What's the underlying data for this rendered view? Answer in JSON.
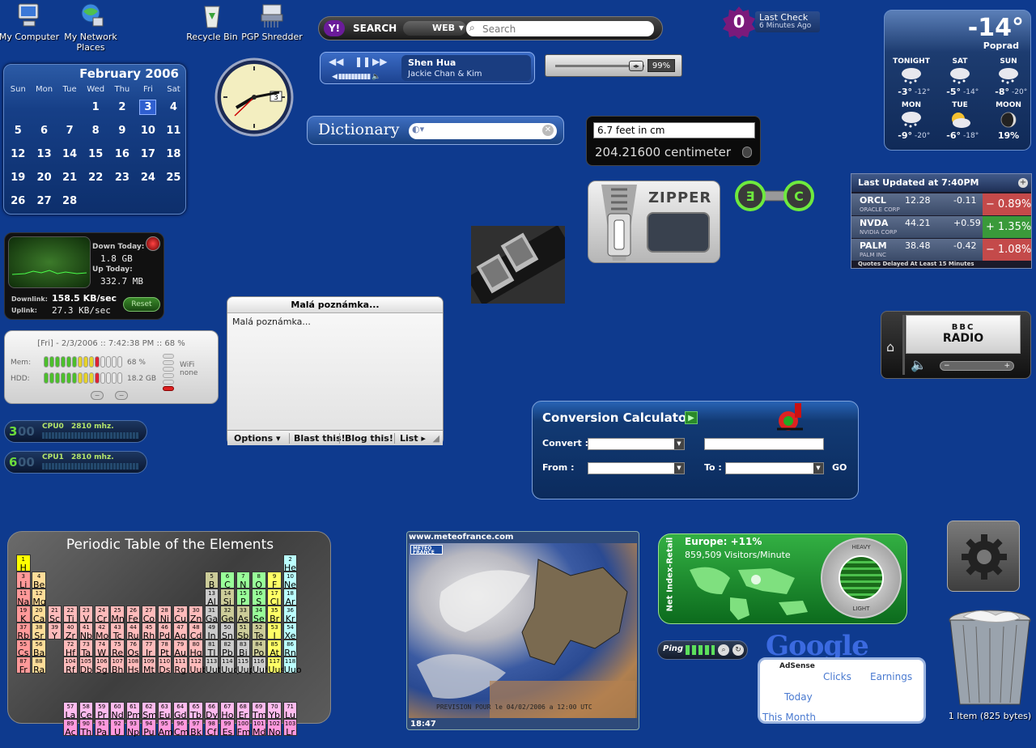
{
  "desktop_icons": [
    {
      "label": "My Computer",
      "icon": "computer-icon"
    },
    {
      "label": "My Network Places",
      "icon": "network-icon"
    },
    {
      "label": "Recycle Bin",
      "icon": "recycle-bin-icon"
    },
    {
      "label": "PGP Shredder",
      "icon": "shredder-icon"
    }
  ],
  "calendar": {
    "month_title": "February 2006",
    "weekdays": [
      "Sun",
      "Mon",
      "Tue",
      "Wed",
      "Thu",
      "Fri",
      "Sat"
    ],
    "weeks": [
      [
        "",
        "",
        "",
        "1",
        "2",
        "3",
        "4"
      ],
      [
        "5",
        "6",
        "7",
        "8",
        "9",
        "10",
        "11"
      ],
      [
        "12",
        "13",
        "14",
        "15",
        "16",
        "17",
        "18"
      ],
      [
        "19",
        "20",
        "21",
        "22",
        "23",
        "24",
        "25"
      ],
      [
        "26",
        "27",
        "28",
        "",
        "",
        "",
        ""
      ]
    ],
    "today": "3"
  },
  "clock": {
    "date_box": "3"
  },
  "yahoo_search": {
    "brand": "Y!",
    "button_label": "SEARCH",
    "scope": "WEB",
    "placeholder": "Search"
  },
  "media_player": {
    "track": "Shen Hua",
    "artist": "Jackie Chan & Kim"
  },
  "volume": {
    "percent_text": "99%",
    "level": 0.99
  },
  "dictionary": {
    "title": "Dictionary",
    "query": ""
  },
  "unit_converter": {
    "input_value": "6.7 feet in cm",
    "result": "204.21600 centimeter"
  },
  "last_check": {
    "count": "0",
    "title": "Last Check",
    "subtitle": "6 Minutes Ago"
  },
  "weather": {
    "temp": "-14°",
    "location": "Poprad",
    "row1": [
      {
        "label": "TONIGHT",
        "hi": "-3°",
        "lo": "-12°"
      },
      {
        "label": "SAT",
        "hi": "-5°",
        "lo": "-14°"
      },
      {
        "label": "SUN",
        "hi": "-8°",
        "lo": "-20°"
      }
    ],
    "row2": [
      {
        "label": "MON",
        "hi": "-9°",
        "lo": "-20°"
      },
      {
        "label": "TUE",
        "hi": "-6°",
        "lo": "-18°"
      },
      {
        "label": "MOON",
        "hi": "19%",
        "lo": ""
      }
    ]
  },
  "zipper": {
    "title": "ZIPPER"
  },
  "stocks": {
    "header": "Last Updated at 7:40PM",
    "rows": [
      {
        "symbol": "ORCL",
        "name": "ORACLE CORP",
        "price": "12.28",
        "change": "-0.11",
        "pct": "0.89%",
        "sign": "−",
        "color": "#c44a4a"
      },
      {
        "symbol": "NVDA",
        "name": "NVIDIA CORP",
        "price": "44.21",
        "change": "+0.59",
        "pct": "1.35%",
        "sign": "+",
        "color": "#3a9a3a"
      },
      {
        "symbol": "PALM",
        "name": "PALM INC",
        "price": "38.48",
        "change": "-0.42",
        "pct": "1.08%",
        "sign": "−",
        "color": "#c44a4a"
      }
    ],
    "footer": "Quotes Delayed At Least 15 Minutes"
  },
  "network_meter": {
    "down_today_label": "Down Today:",
    "down_today": "1.8 GB",
    "up_today_label": "Up Today:",
    "up_today": "332.7 MB",
    "downlink_label": "Downlink:",
    "downlink": "158.5 KB/sec",
    "uplink_label": "Uplink:",
    "uplink": "27.3 KB/sec",
    "reset": "Reset"
  },
  "system_monitor": {
    "header": "[Fri] - 2/3/2006 :: 7:42:38 PM :: 68 %",
    "mem_label": "Mem:",
    "mem_value": "68 %",
    "mem_level": 0.68,
    "hdd_label": "HDD:",
    "hdd_value": "18.2 GB",
    "wifi_label": "WiFi",
    "wifi_value": "none"
  },
  "note": {
    "title": "Malá poznámka...",
    "body": "Malá poznámka...",
    "buttons": [
      "Options ▾",
      "Blast this!",
      "Blog this!",
      "List ▸"
    ]
  },
  "cpu_meters": [
    {
      "digit": "3",
      "faded": "00",
      "label": "CPU0",
      "mhz": "2810 mhz."
    },
    {
      "digit": "6",
      "faded": "00",
      "label": "CPU1",
      "mhz": "2810 mhz."
    }
  ],
  "converter": {
    "title": "Conversion Calculator",
    "convert_label": "Convert :",
    "from_label": "From :",
    "to_label": "To :",
    "go": "GO"
  },
  "bbc_radio": {
    "logo": "BBC",
    "name": "RADIO"
  },
  "periodic": {
    "title": "Periodic Table of the Elements",
    "elements": [
      [
        "1",
        "H",
        1,
        1,
        "#ff0"
      ],
      [
        "2",
        "He",
        18,
        1,
        "#bff"
      ],
      [
        "3",
        "Li",
        1,
        2,
        "#f99"
      ],
      [
        "4",
        "Be",
        2,
        2,
        "#fd9"
      ],
      [
        "5",
        "B",
        13,
        2,
        "#cc9"
      ],
      [
        "6",
        "C",
        14,
        2,
        "#9f9"
      ],
      [
        "7",
        "N",
        15,
        2,
        "#9f9"
      ],
      [
        "8",
        "O",
        16,
        2,
        "#9f9"
      ],
      [
        "9",
        "F",
        17,
        2,
        "#ff6"
      ],
      [
        "10",
        "Ne",
        18,
        2,
        "#bff"
      ],
      [
        "11",
        "Na",
        1,
        3,
        "#f99"
      ],
      [
        "12",
        "Mg",
        2,
        3,
        "#fd9"
      ],
      [
        "13",
        "Al",
        13,
        3,
        "#ccc"
      ],
      [
        "14",
        "Si",
        14,
        3,
        "#cc9"
      ],
      [
        "15",
        "P",
        15,
        3,
        "#9f9"
      ],
      [
        "16",
        "S",
        16,
        3,
        "#9f9"
      ],
      [
        "17",
        "Cl",
        17,
        3,
        "#ff6"
      ],
      [
        "18",
        "Ar",
        18,
        3,
        "#bff"
      ],
      [
        "19",
        "K",
        1,
        4,
        "#f99"
      ],
      [
        "20",
        "Ca",
        2,
        4,
        "#fd9"
      ],
      [
        "21",
        "Sc",
        3,
        4,
        "#fbb"
      ],
      [
        "22",
        "Ti",
        4,
        4,
        "#fbb"
      ],
      [
        "23",
        "V",
        5,
        4,
        "#fbb"
      ],
      [
        "24",
        "Cr",
        6,
        4,
        "#fbb"
      ],
      [
        "25",
        "Mn",
        7,
        4,
        "#fbb"
      ],
      [
        "26",
        "Fe",
        8,
        4,
        "#fbb"
      ],
      [
        "27",
        "Co",
        9,
        4,
        "#fbb"
      ],
      [
        "28",
        "Ni",
        10,
        4,
        "#fbb"
      ],
      [
        "29",
        "Cu",
        11,
        4,
        "#fbb"
      ],
      [
        "30",
        "Zn",
        12,
        4,
        "#fbb"
      ],
      [
        "31",
        "Ga",
        13,
        4,
        "#ccc"
      ],
      [
        "32",
        "Ge",
        14,
        4,
        "#cc9"
      ],
      [
        "33",
        "As",
        15,
        4,
        "#cc9"
      ],
      [
        "34",
        "Se",
        16,
        4,
        "#9f9"
      ],
      [
        "35",
        "Br",
        17,
        4,
        "#ff6"
      ],
      [
        "36",
        "Kr",
        18,
        4,
        "#bff"
      ],
      [
        "37",
        "Rb",
        1,
        5,
        "#f99"
      ],
      [
        "38",
        "Sr",
        2,
        5,
        "#fd9"
      ],
      [
        "39",
        "Y",
        3,
        5,
        "#fbb"
      ],
      [
        "40",
        "Zr",
        4,
        5,
        "#fbb"
      ],
      [
        "41",
        "Nb",
        5,
        5,
        "#fbb"
      ],
      [
        "42",
        "Mo",
        6,
        5,
        "#fbb"
      ],
      [
        "43",
        "Tc",
        7,
        5,
        "#fbb"
      ],
      [
        "44",
        "Ru",
        8,
        5,
        "#fbb"
      ],
      [
        "45",
        "Rh",
        9,
        5,
        "#fbb"
      ],
      [
        "46",
        "Pd",
        10,
        5,
        "#fbb"
      ],
      [
        "47",
        "Ag",
        11,
        5,
        "#fbb"
      ],
      [
        "48",
        "Cd",
        12,
        5,
        "#fbb"
      ],
      [
        "49",
        "In",
        13,
        5,
        "#ccc"
      ],
      [
        "50",
        "Sn",
        14,
        5,
        "#ccc"
      ],
      [
        "51",
        "Sb",
        15,
        5,
        "#cc9"
      ],
      [
        "52",
        "Te",
        16,
        5,
        "#cc9"
      ],
      [
        "53",
        "I",
        17,
        5,
        "#ff6"
      ],
      [
        "54",
        "Xe",
        18,
        5,
        "#bff"
      ],
      [
        "55",
        "Cs",
        1,
        6,
        "#f99"
      ],
      [
        "56",
        "Ba",
        2,
        6,
        "#fd9"
      ],
      [
        "72",
        "Hf",
        4,
        6,
        "#fbb"
      ],
      [
        "73",
        "Ta",
        5,
        6,
        "#fbb"
      ],
      [
        "74",
        "W",
        6,
        6,
        "#fbb"
      ],
      [
        "75",
        "Re",
        7,
        6,
        "#fbb"
      ],
      [
        "76",
        "Os",
        8,
        6,
        "#fbb"
      ],
      [
        "77",
        "Ir",
        9,
        6,
        "#fbb"
      ],
      [
        "78",
        "Pt",
        10,
        6,
        "#fbb"
      ],
      [
        "79",
        "Au",
        11,
        6,
        "#fbb"
      ],
      [
        "80",
        "Hg",
        12,
        6,
        "#fbb"
      ],
      [
        "81",
        "Tl",
        13,
        6,
        "#ccc"
      ],
      [
        "82",
        "Pb",
        14,
        6,
        "#ccc"
      ],
      [
        "83",
        "Bi",
        15,
        6,
        "#ccc"
      ],
      [
        "84",
        "Po",
        16,
        6,
        "#cc9"
      ],
      [
        "85",
        "At",
        17,
        6,
        "#ff6"
      ],
      [
        "86",
        "Rn",
        18,
        6,
        "#bff"
      ],
      [
        "87",
        "Fr",
        1,
        7,
        "#f99"
      ],
      [
        "88",
        "Ra",
        2,
        7,
        "#fd9"
      ],
      [
        "104",
        "Rf",
        4,
        7,
        "#fbb"
      ],
      [
        "105",
        "Db",
        5,
        7,
        "#fbb"
      ],
      [
        "106",
        "Sg",
        6,
        7,
        "#fbb"
      ],
      [
        "107",
        "Bh",
        7,
        7,
        "#fbb"
      ],
      [
        "108",
        "Hs",
        8,
        7,
        "#fbb"
      ],
      [
        "109",
        "Mt",
        9,
        7,
        "#fbb"
      ],
      [
        "110",
        "Ds",
        10,
        7,
        "#fbb"
      ],
      [
        "111",
        "Rg",
        11,
        7,
        "#fbb"
      ],
      [
        "112",
        "Uub",
        12,
        7,
        "#fbb"
      ],
      [
        "113",
        "Uut",
        13,
        7,
        "#ccc"
      ],
      [
        "114",
        "Uuq",
        14,
        7,
        "#ccc"
      ],
      [
        "115",
        "Uup",
        15,
        7,
        "#ccc"
      ],
      [
        "116",
        "Uuh",
        16,
        7,
        "#ccc"
      ],
      [
        "117",
        "Uus",
        17,
        7,
        "#ff6"
      ],
      [
        "118",
        "Uuo",
        18,
        7,
        "#bff"
      ],
      [
        "57",
        "La",
        4,
        9,
        "#fbe"
      ],
      [
        "58",
        "Ce",
        5,
        9,
        "#fbe"
      ],
      [
        "59",
        "Pr",
        6,
        9,
        "#fbe"
      ],
      [
        "60",
        "Nd",
        7,
        9,
        "#fbe"
      ],
      [
        "61",
        "Pm",
        8,
        9,
        "#fbe"
      ],
      [
        "62",
        "Sm",
        9,
        9,
        "#fbe"
      ],
      [
        "63",
        "Eu",
        10,
        9,
        "#fbe"
      ],
      [
        "64",
        "Gd",
        11,
        9,
        "#fbe"
      ],
      [
        "65",
        "Tb",
        12,
        9,
        "#fbe"
      ],
      [
        "66",
        "Dy",
        13,
        9,
        "#fbe"
      ],
      [
        "67",
        "Ho",
        14,
        9,
        "#fbe"
      ],
      [
        "68",
        "Er",
        15,
        9,
        "#fbe"
      ],
      [
        "69",
        "Tm",
        16,
        9,
        "#fbe"
      ],
      [
        "70",
        "Yb",
        17,
        9,
        "#fbe"
      ],
      [
        "71",
        "Lu",
        18,
        9,
        "#fbe"
      ],
      [
        "89",
        "Ac",
        4,
        10,
        "#f9d"
      ],
      [
        "90",
        "Th",
        5,
        10,
        "#f9d"
      ],
      [
        "91",
        "Pa",
        6,
        10,
        "#f9d"
      ],
      [
        "92",
        "U",
        7,
        10,
        "#f9d"
      ],
      [
        "93",
        "Np",
        8,
        10,
        "#f9d"
      ],
      [
        "94",
        "Pu",
        9,
        10,
        "#f9d"
      ],
      [
        "95",
        "Am",
        10,
        10,
        "#f9d"
      ],
      [
        "96",
        "Cm",
        11,
        10,
        "#f9d"
      ],
      [
        "97",
        "Bk",
        12,
        10,
        "#f9d"
      ],
      [
        "98",
        "Cf",
        13,
        10,
        "#f9d"
      ],
      [
        "99",
        "Es",
        14,
        10,
        "#f9d"
      ],
      [
        "100",
        "Fm",
        15,
        10,
        "#f9d"
      ],
      [
        "101",
        "Md",
        16,
        10,
        "#f9d"
      ],
      [
        "102",
        "No",
        17,
        10,
        "#f9d"
      ],
      [
        "103",
        "Lr",
        18,
        10,
        "#f9d"
      ]
    ]
  },
  "meteo": {
    "site": "www.meteofrance.com",
    "logo": "METEO FRANCE",
    "caption": "PREVISION POUR le 04/02/2006 a 12:00 UTC",
    "time": "18:47"
  },
  "net_index": {
    "region": "Europe: +11%",
    "visitors": "859,509 Visitors/Minute",
    "vertical_label": "Net Index-Retail",
    "heavy": "HEAVY",
    "light": "LIGHT"
  },
  "ping": {
    "label": "Ping"
  },
  "adsense": {
    "logo": "Google",
    "sub": "AdSense",
    "clicks": "Clicks",
    "earnings": "Earnings",
    "today": "Today",
    "this_month": "This Month"
  },
  "recycle_full": {
    "label": "1 Item (825 bytes)"
  }
}
